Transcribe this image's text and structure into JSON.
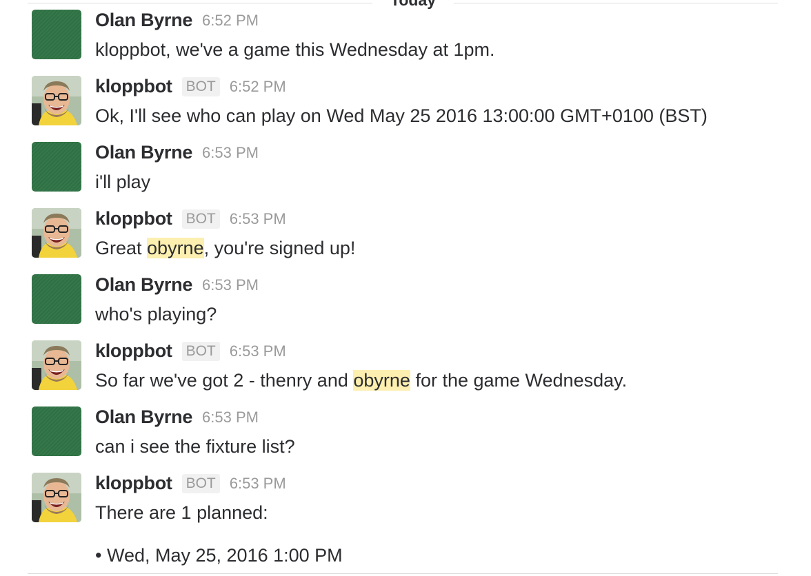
{
  "divider": {
    "label": "Today"
  },
  "messages": [
    {
      "sender": "Olan Byrne",
      "is_bot": false,
      "time": "6:52 PM",
      "text": [
        {
          "t": "kloppbot, we've a game this Wednesday at 1pm."
        }
      ]
    },
    {
      "sender": "kloppbot",
      "is_bot": true,
      "badge": "BOT",
      "time": "6:52 PM",
      "text": [
        {
          "t": "Ok, I'll see who can play on Wed May 25 2016 13:00:00 GMT+0100 (BST)"
        }
      ]
    },
    {
      "sender": "Olan Byrne",
      "is_bot": false,
      "time": "6:53 PM",
      "text": [
        {
          "t": "i'll play"
        }
      ]
    },
    {
      "sender": "kloppbot",
      "is_bot": true,
      "badge": "BOT",
      "time": "6:53 PM",
      "text": [
        {
          "t": "Great "
        },
        {
          "t": "obyrne",
          "mention": true
        },
        {
          "t": ", you're signed up!"
        }
      ]
    },
    {
      "sender": "Olan Byrne",
      "is_bot": false,
      "time": "6:53 PM",
      "text": [
        {
          "t": "who's playing?"
        }
      ]
    },
    {
      "sender": "kloppbot",
      "is_bot": true,
      "badge": "BOT",
      "time": "6:53 PM",
      "text": [
        {
          "t": "So far we've got 2 - thenry and "
        },
        {
          "t": "obyrne",
          "mention": true
        },
        {
          "t": " for the game Wednesday."
        }
      ]
    },
    {
      "sender": "Olan Byrne",
      "is_bot": false,
      "time": "6:53 PM",
      "text": [
        {
          "t": "can i see the fixture list?"
        }
      ]
    },
    {
      "sender": "kloppbot",
      "is_bot": true,
      "badge": "BOT",
      "time": "6:53 PM",
      "text": [
        {
          "t": "There are 1 planned:"
        }
      ]
    }
  ],
  "fixture_list": {
    "bullet": "•",
    "items": [
      "Wed, May 25, 2016 1:00 PM"
    ]
  },
  "icons": {
    "human_avatar": "green-avatar-icon",
    "bot_avatar": "kloppbot-avatar-icon"
  },
  "colors": {
    "mention_highlight": "#fcefb0",
    "avatar_green": "#357a4a",
    "muted_text": "#9a9a9a"
  }
}
